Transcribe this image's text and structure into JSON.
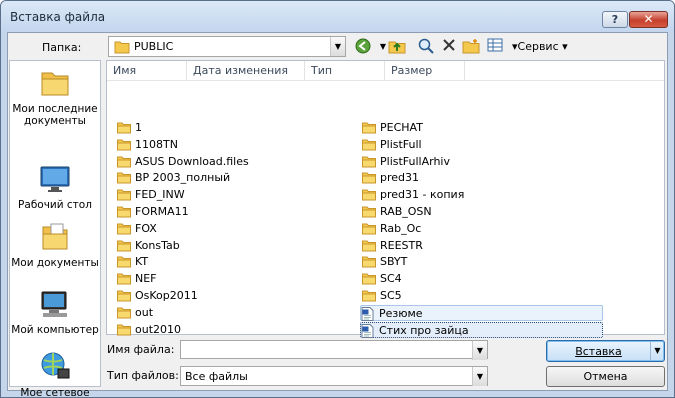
{
  "window": {
    "title": "Вставка файла",
    "help_symbol": "?",
    "close_symbol": "✕"
  },
  "toolbar": {
    "folder_label": "Папка:",
    "current_folder": "PUBLIC",
    "service_label": "▾Сервис ▾"
  },
  "places": [
    {
      "label": "Мои последние документы",
      "icon": "recent-docs-icon"
    },
    {
      "label": "Рабочий стол",
      "icon": "desktop-icon"
    },
    {
      "label": "Мои документы",
      "icon": "my-docs-icon"
    },
    {
      "label": "Мой компьютер",
      "icon": "computer-icon"
    },
    {
      "label": "Мое сетевое окружение",
      "icon": "network-icon"
    }
  ],
  "columns": [
    "Имя",
    "Дата изменения",
    "Тип",
    "Размер"
  ],
  "files_col1": [
    "1",
    "1108TN",
    "ASUS Download.files",
    "BP 2003_полный",
    "FED_INW",
    "FORMA11",
    "FOX",
    "KonsTab",
    "KT",
    "NEF",
    "OsKop2011",
    "out",
    "out2010"
  ],
  "files_col2": [
    "PECHAT",
    "PlistFull",
    "PlistFullArhiv",
    "pred31",
    "pred31 - копия",
    "RAB_OSN",
    "Rab_Oc",
    "REESTR",
    "SBYT",
    "SC4",
    "SC5"
  ],
  "docs": [
    "Резюме",
    "Стих про зайца"
  ],
  "bottom": {
    "filename_label": "Имя файла:",
    "filename_value": "",
    "filetype_label": "Тип файлов:",
    "filetype_value": "Все файлы",
    "insert_label": "Вставка",
    "cancel_label": "Отмена"
  }
}
